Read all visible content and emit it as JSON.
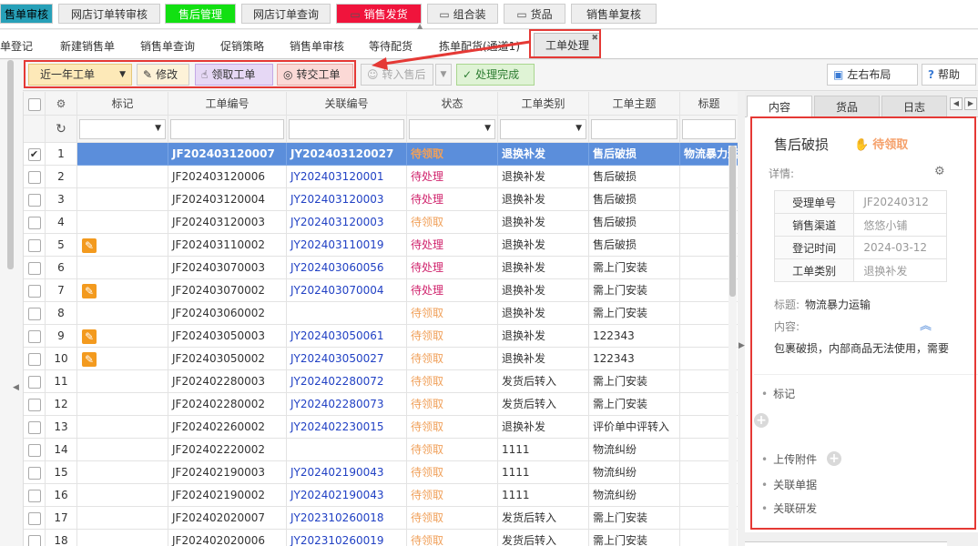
{
  "top_tabs": [
    {
      "label": "售单审核",
      "bg": "#27a0b8",
      "fg": "#000000"
    },
    {
      "label": "网店订单转审核",
      "bg": "#eeeeee",
      "fg": "#333333"
    },
    {
      "label": "售后管理",
      "bg": "#12e012",
      "fg": "#ffffff"
    },
    {
      "label": "网店订单查询",
      "bg": "#eeeeee",
      "fg": "#333333"
    },
    {
      "label": "销售发货",
      "bg": "#f0143c",
      "fg": "#ffffff"
    },
    {
      "label": "组合装",
      "bg": "#eeeeee",
      "fg": "#333333"
    },
    {
      "label": "货品",
      "bg": "#eeeeee",
      "fg": "#333333"
    },
    {
      "label": "销售单复核",
      "bg": "#eeeeee",
      "fg": "#333333"
    }
  ],
  "sub_tabs": [
    "单登记",
    "新建销售单",
    "销售单查询",
    "促销策略",
    "销售单审核",
    "等待配货",
    "拣单配货(通道1)",
    "工单处理"
  ],
  "toolbar": {
    "period": "近一年工单",
    "edit": "修改",
    "claim": "领取工单",
    "transfer": "转交工单",
    "to_aftersale": "转入售后",
    "done": "处理完成",
    "layout": "左右布局",
    "help": "帮助"
  },
  "grid": {
    "headers": [
      "标记",
      "工单编号",
      "关联编号",
      "状态",
      "工单类别",
      "工单主题",
      "标题"
    ],
    "rows": [
      {
        "n": "1",
        "checked": "✔",
        "mark": "",
        "id": "JF202403120007",
        "ref": "JY202403120027",
        "status": "待领取",
        "cat": "退换补发",
        "topic": "售后破损",
        "title": "物流暴力运"
      },
      {
        "n": "2",
        "checked": "",
        "mark": "",
        "id": "JF202403120006",
        "ref": "JY202403120001",
        "status": "待处理",
        "cat": "退换补发",
        "topic": "售后破损",
        "title": ""
      },
      {
        "n": "3",
        "checked": "",
        "mark": "",
        "id": "JF202403120004",
        "ref": "JY202403120003",
        "status": "待处理",
        "cat": "退换补发",
        "topic": "售后破损",
        "title": ""
      },
      {
        "n": "4",
        "checked": "",
        "mark": "",
        "id": "JF202403120003",
        "ref": "JY202403120003",
        "status": "待领取",
        "cat": "退换补发",
        "topic": "售后破损",
        "title": ""
      },
      {
        "n": "5",
        "checked": "",
        "mark": "wrench",
        "id": "JF202403110002",
        "ref": "JY202403110019",
        "status": "待处理",
        "cat": "退换补发",
        "topic": "售后破损",
        "title": ""
      },
      {
        "n": "6",
        "checked": "",
        "mark": "",
        "id": "JF202403070003",
        "ref": "JY202403060056",
        "status": "待处理",
        "cat": "退换补发",
        "topic": "需上门安装",
        "title": ""
      },
      {
        "n": "7",
        "checked": "",
        "mark": "wrench",
        "id": "JF202403070002",
        "ref": "JY202403070004",
        "status": "待处理",
        "cat": "退换补发",
        "topic": "需上门安装",
        "title": ""
      },
      {
        "n": "8",
        "checked": "",
        "mark": "",
        "id": "JF202403060002",
        "ref": "",
        "status": "待领取",
        "cat": "退换补发",
        "topic": "需上门安装",
        "title": ""
      },
      {
        "n": "9",
        "checked": "",
        "mark": "wrench",
        "id": "JF202403050003",
        "ref": "JY202403050061",
        "status": "待领取",
        "cat": "退换补发",
        "topic": "122343",
        "title": ""
      },
      {
        "n": "10",
        "checked": "",
        "mark": "wrench",
        "id": "JF202403050002",
        "ref": "JY202403050027",
        "status": "待领取",
        "cat": "退换补发",
        "topic": "122343",
        "title": ""
      },
      {
        "n": "11",
        "checked": "",
        "mark": "",
        "id": "JF202402280003",
        "ref": "JY202402280072",
        "status": "待领取",
        "cat": "发货后转入",
        "topic": "需上门安装",
        "title": ""
      },
      {
        "n": "12",
        "checked": "",
        "mark": "",
        "id": "JF202402280002",
        "ref": "JY202402280073",
        "status": "待领取",
        "cat": "发货后转入",
        "topic": "需上门安装",
        "title": ""
      },
      {
        "n": "13",
        "checked": "",
        "mark": "",
        "id": "JF202402260002",
        "ref": "JY202402230015",
        "status": "待领取",
        "cat": "退换补发",
        "topic": "评价单中评转入",
        "title": ""
      },
      {
        "n": "14",
        "checked": "",
        "mark": "",
        "id": "JF202402220002",
        "ref": "",
        "status": "待领取",
        "cat": "1111",
        "topic": "物流纠纷",
        "title": ""
      },
      {
        "n": "15",
        "checked": "",
        "mark": "",
        "id": "JF202402190003",
        "ref": "JY202402190043",
        "status": "待领取",
        "cat": "1111",
        "topic": "物流纠纷",
        "title": ""
      },
      {
        "n": "16",
        "checked": "",
        "mark": "",
        "id": "JF202402190002",
        "ref": "JY202402190043",
        "status": "待领取",
        "cat": "1111",
        "topic": "物流纠纷",
        "title": ""
      },
      {
        "n": "17",
        "checked": "",
        "mark": "",
        "id": "JF202402020007",
        "ref": "JY202310260018",
        "status": "待领取",
        "cat": "发货后转入",
        "topic": "需上门安装",
        "title": ""
      },
      {
        "n": "18",
        "checked": "",
        "mark": "",
        "id": "JF202402020006",
        "ref": "JY202310260019",
        "status": "待领取",
        "cat": "发货后转入",
        "topic": "需上门安装",
        "title": ""
      }
    ]
  },
  "panel": {
    "tabs": [
      "内容",
      "货品",
      "日志"
    ],
    "title": "售后破损",
    "status": "待领取",
    "detail_label": "详情:",
    "details": [
      {
        "k": "受理单号",
        "v": "JF20240312"
      },
      {
        "k": "销售渠道",
        "v": "悠悠小铺"
      },
      {
        "k": "登记时间",
        "v": "2024-03-12"
      },
      {
        "k": "工单类别",
        "v": "退换补发"
      }
    ],
    "subject_label": "标题:",
    "subject": "物流暴力运输",
    "content_label": "内容:",
    "content": "包裹破损，内部商品无法使用，需要",
    "mark_label": "标记",
    "upload_label": "上传附件",
    "rel_orders_label": "关联单据",
    "rel_dev_label": "关联研发"
  },
  "colors": {
    "accent": "#e53935",
    "link": "#2141c4",
    "pending": "#f0a05a",
    "processing": "#d0246d",
    "selected_row": "#5b8edb"
  }
}
